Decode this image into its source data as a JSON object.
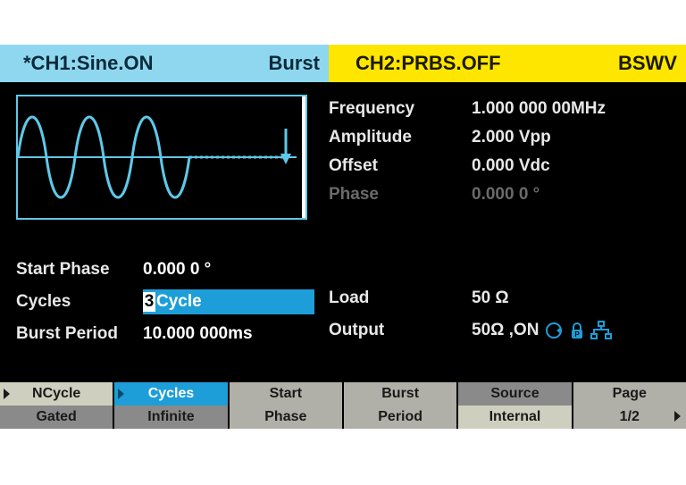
{
  "header": {
    "ch1": {
      "label": "*CH1:Sine.ON",
      "mode": "Burst"
    },
    "ch2": {
      "label": "CH2:PRBS.OFF",
      "mode": "BSWV"
    }
  },
  "params_top": {
    "frequency": {
      "label": "Frequency",
      "value": "1.000 000 00MHz"
    },
    "amplitude": {
      "label": "Amplitude",
      "value": "2.000 Vpp"
    },
    "offset": {
      "label": "Offset",
      "value": "0.000 Vdc"
    },
    "phase": {
      "label": "Phase",
      "value": "0.000 0 °"
    }
  },
  "params_bot": {
    "start_phase": {
      "label": "Start Phase",
      "value": "0.000 0 °"
    },
    "cycles": {
      "label": "Cycles",
      "digit": "3",
      "unit": "Cycle"
    },
    "burst_period": {
      "label": "Burst Period",
      "value": "10.000 000ms"
    }
  },
  "params_br": {
    "load": {
      "label": "Load",
      "value": "50 Ω"
    },
    "output": {
      "label": "Output",
      "value": "50Ω ,ON"
    }
  },
  "softkeys": {
    "k1": {
      "top": "NCycle",
      "bot": "Gated"
    },
    "k2": {
      "top": "Cycles",
      "bot": "Infinite"
    },
    "k3": {
      "top": "Start",
      "bot": "Phase"
    },
    "k4": {
      "top": "Burst",
      "bot": "Period"
    },
    "k5": {
      "top": "Source",
      "bot": "Internal"
    },
    "k6": {
      "top": "Page",
      "bot": "1/2"
    }
  },
  "icons": {
    "sync": "sync-icon",
    "lock": "lock-icon",
    "net": "network-icon"
  }
}
